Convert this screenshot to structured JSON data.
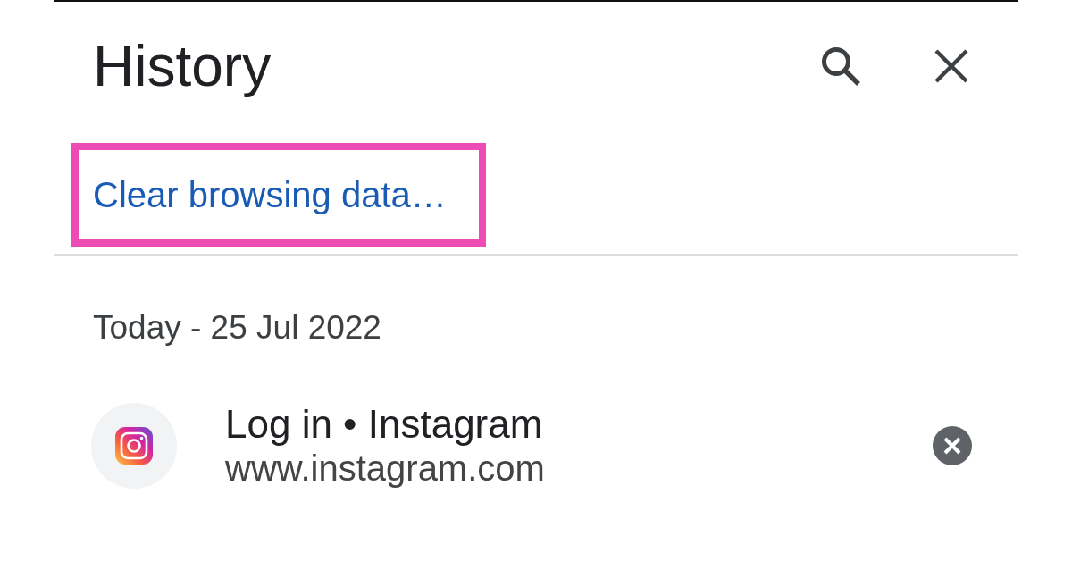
{
  "header": {
    "title": "History"
  },
  "clear_browsing_data": {
    "label": "Clear browsing data…",
    "highlighted": true
  },
  "history_groups": [
    {
      "date": "Today - 25 Jul 2022",
      "items": [
        {
          "title": "Log in • Instagram",
          "url": "www.instagram.com"
        }
      ]
    }
  ]
}
